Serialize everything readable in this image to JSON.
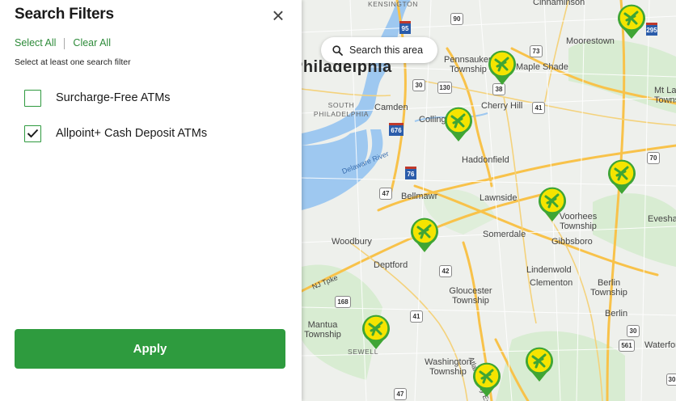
{
  "filters": {
    "title": "Search Filters",
    "close_symbol": "×",
    "select_all": "Select All",
    "clear_all": "Clear All",
    "hint": "Select at least one search filter",
    "options": [
      {
        "label": "Surcharge-Free ATMs",
        "checked": false
      },
      {
        "label": "Allpoint+ Cash Deposit ATMs",
        "checked": true
      }
    ],
    "apply_label": "Apply"
  },
  "map": {
    "search_button": "Search this area",
    "places": [
      "KENSINGTON",
      "Cinnaminson",
      "Moorestown",
      "Pennsauken Township",
      "Maple Shade",
      "Mt Laurel Township",
      "Philadelphia",
      "SOUTH PHILADELPHIA",
      "Camden",
      "Cherry Hill",
      "Collingswood",
      "Haddonfield",
      "Delaware River",
      "Bellmawr",
      "Lawnside",
      "Voorhees Township",
      "Evesham",
      "Gibbsboro",
      "Woodbury",
      "Deptford",
      "Somerdale",
      "NJ Tpke",
      "Lindenwold",
      "Clementon",
      "Gloucester Township",
      "Berlin Township",
      "Berlin",
      "Mantua Township",
      "SEWELL",
      "Washington Township",
      "Waterford",
      "Atlantic City Expy"
    ],
    "highway_shields": [
      "95",
      "90",
      "295",
      "73",
      "30",
      "130",
      "38",
      "41",
      "676",
      "76",
      "47",
      "70",
      "42",
      "168",
      "41",
      "30",
      "561",
      "47",
      "30"
    ],
    "colors": {
      "accent": "#2e9b3e",
      "marker_fill": "#f5e400",
      "marker_pin": "#3fa535",
      "water": "#9ec8f0",
      "park": "#cfe8c9"
    }
  }
}
